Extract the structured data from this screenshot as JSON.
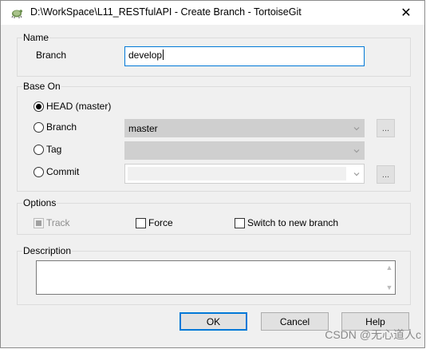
{
  "window": {
    "title": "D:\\WorkSpace\\L11_RESTfulAPI - Create Branch - TortoiseGit",
    "close_glyph": "✕"
  },
  "name_group": {
    "label": "Name",
    "branch_label": "Branch",
    "branch_value": "develop"
  },
  "base_on": {
    "label": "Base On",
    "head_label": "HEAD (master)",
    "branch_label": "Branch",
    "branch_combo_value": "master",
    "tag_label": "Tag",
    "commit_label": "Commit",
    "browse_label": "..."
  },
  "options": {
    "label": "Options",
    "track_label": "Track",
    "force_label": "Force",
    "switch_label": "Switch to new branch"
  },
  "description": {
    "label": "Description"
  },
  "buttons": {
    "ok": "OK",
    "cancel": "Cancel",
    "help": "Help"
  },
  "watermark": "CSDN @无心道人c",
  "icons": {
    "app": "tortoisegit-icon",
    "close": "close-icon",
    "chevron": "chevron-down-icon"
  }
}
